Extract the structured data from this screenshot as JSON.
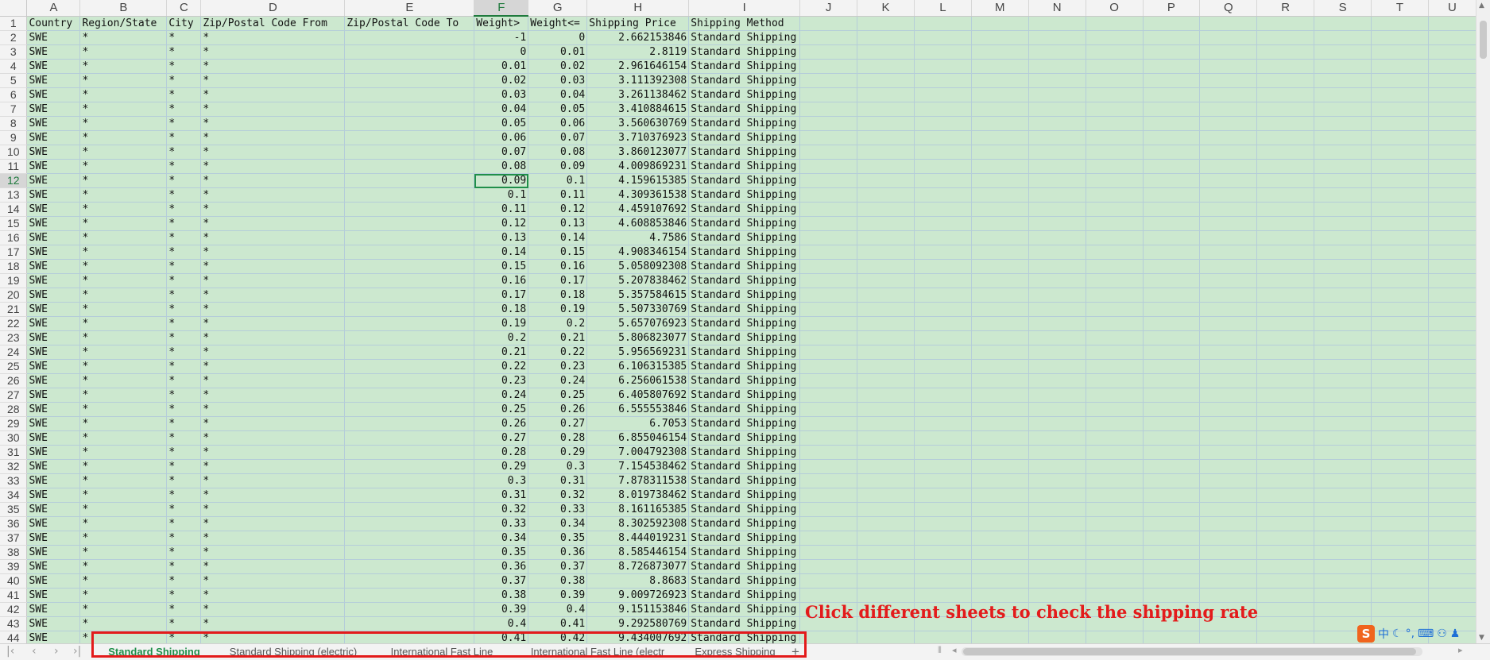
{
  "columns": [
    "A",
    "B",
    "C",
    "D",
    "E",
    "F",
    "G",
    "H",
    "I",
    "J",
    "K",
    "L",
    "M",
    "N",
    "O",
    "P",
    "Q",
    "R",
    "S",
    "T",
    "U"
  ],
  "active_column": "F",
  "active_row": "12",
  "header_row": {
    "row": "1",
    "cells": [
      "Country",
      "Region/State",
      "City",
      "Zip/Postal Code From",
      "Zip/Postal Code To",
      "Weight>",
      "Weight<=",
      "Shipping Price",
      "Shipping Method"
    ]
  },
  "rows": [
    {
      "row": "2",
      "country": "SWE",
      "region": "*",
      "city": "*",
      "zip_from": "*",
      "zip_to": "",
      "weight_gt": "-1",
      "weight_le": "0",
      "price": "2.662153846",
      "method": "Standard Shipping"
    },
    {
      "row": "3",
      "country": "SWE",
      "region": "*",
      "city": "*",
      "zip_from": "*",
      "zip_to": "",
      "weight_gt": "0",
      "weight_le": "0.01",
      "price": "2.8119",
      "method": "Standard Shipping"
    },
    {
      "row": "4",
      "country": "SWE",
      "region": "*",
      "city": "*",
      "zip_from": "*",
      "zip_to": "",
      "weight_gt": "0.01",
      "weight_le": "0.02",
      "price": "2.961646154",
      "method": "Standard Shipping"
    },
    {
      "row": "5",
      "country": "SWE",
      "region": "*",
      "city": "*",
      "zip_from": "*",
      "zip_to": "",
      "weight_gt": "0.02",
      "weight_le": "0.03",
      "price": "3.111392308",
      "method": "Standard Shipping"
    },
    {
      "row": "6",
      "country": "SWE",
      "region": "*",
      "city": "*",
      "zip_from": "*",
      "zip_to": "",
      "weight_gt": "0.03",
      "weight_le": "0.04",
      "price": "3.261138462",
      "method": "Standard Shipping"
    },
    {
      "row": "7",
      "country": "SWE",
      "region": "*",
      "city": "*",
      "zip_from": "*",
      "zip_to": "",
      "weight_gt": "0.04",
      "weight_le": "0.05",
      "price": "3.410884615",
      "method": "Standard Shipping"
    },
    {
      "row": "8",
      "country": "SWE",
      "region": "*",
      "city": "*",
      "zip_from": "*",
      "zip_to": "",
      "weight_gt": "0.05",
      "weight_le": "0.06",
      "price": "3.560630769",
      "method": "Standard Shipping"
    },
    {
      "row": "9",
      "country": "SWE",
      "region": "*",
      "city": "*",
      "zip_from": "*",
      "zip_to": "",
      "weight_gt": "0.06",
      "weight_le": "0.07",
      "price": "3.710376923",
      "method": "Standard Shipping"
    },
    {
      "row": "10",
      "country": "SWE",
      "region": "*",
      "city": "*",
      "zip_from": "*",
      "zip_to": "",
      "weight_gt": "0.07",
      "weight_le": "0.08",
      "price": "3.860123077",
      "method": "Standard Shipping"
    },
    {
      "row": "11",
      "country": "SWE",
      "region": "*",
      "city": "*",
      "zip_from": "*",
      "zip_to": "",
      "weight_gt": "0.08",
      "weight_le": "0.09",
      "price": "4.009869231",
      "method": "Standard Shipping"
    },
    {
      "row": "12",
      "country": "SWE",
      "region": "*",
      "city": "*",
      "zip_from": "*",
      "zip_to": "",
      "weight_gt": "0.09",
      "weight_le": "0.1",
      "price": "4.159615385",
      "method": "Standard Shipping"
    },
    {
      "row": "13",
      "country": "SWE",
      "region": "*",
      "city": "*",
      "zip_from": "*",
      "zip_to": "",
      "weight_gt": "0.1",
      "weight_le": "0.11",
      "price": "4.309361538",
      "method": "Standard Shipping"
    },
    {
      "row": "14",
      "country": "SWE",
      "region": "*",
      "city": "*",
      "zip_from": "*",
      "zip_to": "",
      "weight_gt": "0.11",
      "weight_le": "0.12",
      "price": "4.459107692",
      "method": "Standard Shipping"
    },
    {
      "row": "15",
      "country": "SWE",
      "region": "*",
      "city": "*",
      "zip_from": "*",
      "zip_to": "",
      "weight_gt": "0.12",
      "weight_le": "0.13",
      "price": "4.608853846",
      "method": "Standard Shipping"
    },
    {
      "row": "16",
      "country": "SWE",
      "region": "*",
      "city": "*",
      "zip_from": "*",
      "zip_to": "",
      "weight_gt": "0.13",
      "weight_le": "0.14",
      "price": "4.7586",
      "method": "Standard Shipping"
    },
    {
      "row": "17",
      "country": "SWE",
      "region": "*",
      "city": "*",
      "zip_from": "*",
      "zip_to": "",
      "weight_gt": "0.14",
      "weight_le": "0.15",
      "price": "4.908346154",
      "method": "Standard Shipping"
    },
    {
      "row": "18",
      "country": "SWE",
      "region": "*",
      "city": "*",
      "zip_from": "*",
      "zip_to": "",
      "weight_gt": "0.15",
      "weight_le": "0.16",
      "price": "5.058092308",
      "method": "Standard Shipping"
    },
    {
      "row": "19",
      "country": "SWE",
      "region": "*",
      "city": "*",
      "zip_from": "*",
      "zip_to": "",
      "weight_gt": "0.16",
      "weight_le": "0.17",
      "price": "5.207838462",
      "method": "Standard Shipping"
    },
    {
      "row": "20",
      "country": "SWE",
      "region": "*",
      "city": "*",
      "zip_from": "*",
      "zip_to": "",
      "weight_gt": "0.17",
      "weight_le": "0.18",
      "price": "5.357584615",
      "method": "Standard Shipping"
    },
    {
      "row": "21",
      "country": "SWE",
      "region": "*",
      "city": "*",
      "zip_from": "*",
      "zip_to": "",
      "weight_gt": "0.18",
      "weight_le": "0.19",
      "price": "5.507330769",
      "method": "Standard Shipping"
    },
    {
      "row": "22",
      "country": "SWE",
      "region": "*",
      "city": "*",
      "zip_from": "*",
      "zip_to": "",
      "weight_gt": "0.19",
      "weight_le": "0.2",
      "price": "5.657076923",
      "method": "Standard Shipping"
    },
    {
      "row": "23",
      "country": "SWE",
      "region": "*",
      "city": "*",
      "zip_from": "*",
      "zip_to": "",
      "weight_gt": "0.2",
      "weight_le": "0.21",
      "price": "5.806823077",
      "method": "Standard Shipping"
    },
    {
      "row": "24",
      "country": "SWE",
      "region": "*",
      "city": "*",
      "zip_from": "*",
      "zip_to": "",
      "weight_gt": "0.21",
      "weight_le": "0.22",
      "price": "5.956569231",
      "method": "Standard Shipping"
    },
    {
      "row": "25",
      "country": "SWE",
      "region": "*",
      "city": "*",
      "zip_from": "*",
      "zip_to": "",
      "weight_gt": "0.22",
      "weight_le": "0.23",
      "price": "6.106315385",
      "method": "Standard Shipping"
    },
    {
      "row": "26",
      "country": "SWE",
      "region": "*",
      "city": "*",
      "zip_from": "*",
      "zip_to": "",
      "weight_gt": "0.23",
      "weight_le": "0.24",
      "price": "6.256061538",
      "method": "Standard Shipping"
    },
    {
      "row": "27",
      "country": "SWE",
      "region": "*",
      "city": "*",
      "zip_from": "*",
      "zip_to": "",
      "weight_gt": "0.24",
      "weight_le": "0.25",
      "price": "6.405807692",
      "method": "Standard Shipping"
    },
    {
      "row": "28",
      "country": "SWE",
      "region": "*",
      "city": "*",
      "zip_from": "*",
      "zip_to": "",
      "weight_gt": "0.25",
      "weight_le": "0.26",
      "price": "6.555553846",
      "method": "Standard Shipping"
    },
    {
      "row": "29",
      "country": "SWE",
      "region": "*",
      "city": "*",
      "zip_from": "*",
      "zip_to": "",
      "weight_gt": "0.26",
      "weight_le": "0.27",
      "price": "6.7053",
      "method": "Standard Shipping"
    },
    {
      "row": "30",
      "country": "SWE",
      "region": "*",
      "city": "*",
      "zip_from": "*",
      "zip_to": "",
      "weight_gt": "0.27",
      "weight_le": "0.28",
      "price": "6.855046154",
      "method": "Standard Shipping"
    },
    {
      "row": "31",
      "country": "SWE",
      "region": "*",
      "city": "*",
      "zip_from": "*",
      "zip_to": "",
      "weight_gt": "0.28",
      "weight_le": "0.29",
      "price": "7.004792308",
      "method": "Standard Shipping"
    },
    {
      "row": "32",
      "country": "SWE",
      "region": "*",
      "city": "*",
      "zip_from": "*",
      "zip_to": "",
      "weight_gt": "0.29",
      "weight_le": "0.3",
      "price": "7.154538462",
      "method": "Standard Shipping"
    },
    {
      "row": "33",
      "country": "SWE",
      "region": "*",
      "city": "*",
      "zip_from": "*",
      "zip_to": "",
      "weight_gt": "0.3",
      "weight_le": "0.31",
      "price": "7.878311538",
      "method": "Standard Shipping"
    },
    {
      "row": "34",
      "country": "SWE",
      "region": "*",
      "city": "*",
      "zip_from": "*",
      "zip_to": "",
      "weight_gt": "0.31",
      "weight_le": "0.32",
      "price": "8.019738462",
      "method": "Standard Shipping"
    },
    {
      "row": "35",
      "country": "SWE",
      "region": "*",
      "city": "*",
      "zip_from": "*",
      "zip_to": "",
      "weight_gt": "0.32",
      "weight_le": "0.33",
      "price": "8.161165385",
      "method": "Standard Shipping"
    },
    {
      "row": "36",
      "country": "SWE",
      "region": "*",
      "city": "*",
      "zip_from": "*",
      "zip_to": "",
      "weight_gt": "0.33",
      "weight_le": "0.34",
      "price": "8.302592308",
      "method": "Standard Shipping"
    },
    {
      "row": "37",
      "country": "SWE",
      "region": "*",
      "city": "*",
      "zip_from": "*",
      "zip_to": "",
      "weight_gt": "0.34",
      "weight_le": "0.35",
      "price": "8.444019231",
      "method": "Standard Shipping"
    },
    {
      "row": "38",
      "country": "SWE",
      "region": "*",
      "city": "*",
      "zip_from": "*",
      "zip_to": "",
      "weight_gt": "0.35",
      "weight_le": "0.36",
      "price": "8.585446154",
      "method": "Standard Shipping"
    },
    {
      "row": "39",
      "country": "SWE",
      "region": "*",
      "city": "*",
      "zip_from": "*",
      "zip_to": "",
      "weight_gt": "0.36",
      "weight_le": "0.37",
      "price": "8.726873077",
      "method": "Standard Shipping"
    },
    {
      "row": "40",
      "country": "SWE",
      "region": "*",
      "city": "*",
      "zip_from": "*",
      "zip_to": "",
      "weight_gt": "0.37",
      "weight_le": "0.38",
      "price": "8.8683",
      "method": "Standard Shipping"
    },
    {
      "row": "41",
      "country": "SWE",
      "region": "*",
      "city": "*",
      "zip_from": "*",
      "zip_to": "",
      "weight_gt": "0.38",
      "weight_le": "0.39",
      "price": "9.009726923",
      "method": "Standard Shipping"
    },
    {
      "row": "42",
      "country": "SWE",
      "region": "*",
      "city": "*",
      "zip_from": "*",
      "zip_to": "",
      "weight_gt": "0.39",
      "weight_le": "0.4",
      "price": "9.151153846",
      "method": "Standard Shipping"
    },
    {
      "row": "43",
      "country": "SWE",
      "region": "*",
      "city": "*",
      "zip_from": "*",
      "zip_to": "",
      "weight_gt": "0.4",
      "weight_le": "0.41",
      "price": "9.292580769",
      "method": "Standard Shipping"
    },
    {
      "row": "44",
      "country": "SWE",
      "region": "*",
      "city": "*",
      "zip_from": "*",
      "zip_to": "",
      "weight_gt": "0.41",
      "weight_le": "0.42",
      "price": "9.434007692",
      "method": "Standard Shipping"
    }
  ],
  "sheet_tabs": [
    {
      "label": "Standard Shipping",
      "active": true
    },
    {
      "label": "Standard Shipping (electric)",
      "active": false
    },
    {
      "label": "International Fast Line",
      "active": false
    },
    {
      "label": "International Fast Line (electr",
      "active": false
    },
    {
      "label": "Express Shipping",
      "active": false
    }
  ],
  "add_sheet_label": "+",
  "annotation": "Click different sheets to check the shipping rate",
  "ime": {
    "logo": "S",
    "mode": "中"
  },
  "colors": {
    "cell_bg": "#cce8cf",
    "gridline": "#b5cdd9",
    "accent": "#1f8f4a",
    "annotation": "#e31b1b"
  }
}
